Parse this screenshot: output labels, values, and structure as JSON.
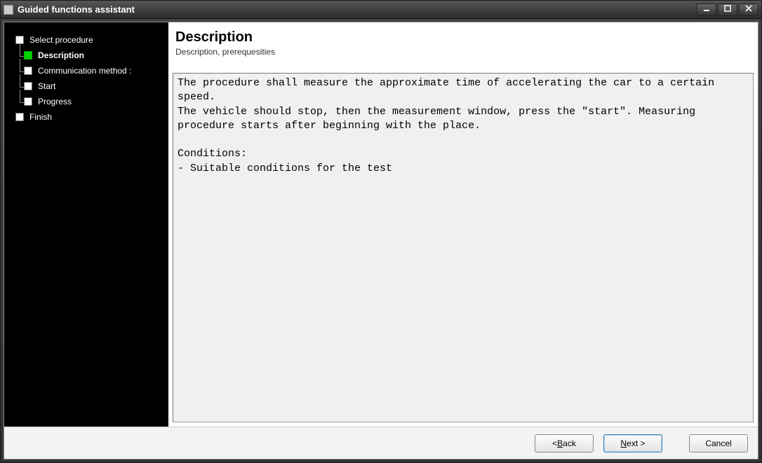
{
  "window": {
    "title": "Guided functions assistant"
  },
  "sidebar": {
    "items": [
      {
        "label": "Select procedure",
        "level": 0,
        "active": false
      },
      {
        "label": "Description",
        "level": 1,
        "active": true
      },
      {
        "label": "Communication method :",
        "level": 1,
        "active": false
      },
      {
        "label": "Start",
        "level": 1,
        "active": false
      },
      {
        "label": "Progress",
        "level": 1,
        "active": false
      },
      {
        "label": "Finish",
        "level": 0,
        "active": false
      }
    ]
  },
  "header": {
    "title": "Description",
    "subtitle": "Description, prerequesities"
  },
  "body": {
    "text": "The procedure shall measure the approximate time of accelerating the car to a certain speed.\nThe vehicle should stop, then the measurement window, press the \"start\". Measuring procedure starts after beginning with the place.\n\nConditions:\n- Suitable conditions for the test"
  },
  "buttons": {
    "back": "< Back",
    "next": "Next >",
    "cancel": "Cancel",
    "back_accel": "B",
    "next_accel": "N"
  }
}
